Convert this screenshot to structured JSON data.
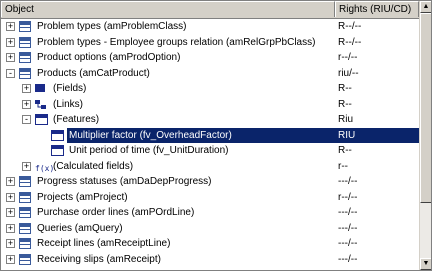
{
  "header": {
    "col_object": "Object",
    "col_rights": "Rights (RIU/CD)"
  },
  "rows": [
    {
      "label": "Problem types (amProblemClass)",
      "rights": "R--/--",
      "level": 0,
      "expander": "+",
      "icon": "table-icon"
    },
    {
      "label": "Problem types - Employee groups relation (amRelGrpPbClass)",
      "rights": "R--/--",
      "level": 0,
      "expander": "+",
      "icon": "table-icon"
    },
    {
      "label": "Product options (amProdOption)",
      "rights": "r--/--",
      "level": 0,
      "expander": "+",
      "icon": "table-icon"
    },
    {
      "label": "Products (amCatProduct)",
      "rights": "riu/--",
      "level": 0,
      "expander": "-",
      "icon": "table-icon"
    },
    {
      "label": "(Fields)",
      "rights": "R--",
      "level": 1,
      "expander": "+",
      "icon": "fields-icon"
    },
    {
      "label": "(Links)",
      "rights": "R--",
      "level": 1,
      "expander": "+",
      "icon": "links-icon"
    },
    {
      "label": "(Features)",
      "rights": "Riu",
      "level": 1,
      "expander": "-",
      "icon": "feature-icon"
    },
    {
      "label": "Multiplier factor (fv_OverheadFactor)",
      "rights": "RIU",
      "level": 2,
      "expander": "",
      "icon": "feature-icon",
      "selected": true
    },
    {
      "label": "Unit period of time (fv_UnitDuration)",
      "rights": "R--",
      "level": 2,
      "expander": "",
      "icon": "feature-icon"
    },
    {
      "label": "(Calculated fields)",
      "rights": "r--",
      "level": 1,
      "expander": "+",
      "icon": "calc-icon"
    },
    {
      "label": "Progress statuses (amDaDepProgress)",
      "rights": "---/--",
      "level": 0,
      "expander": "+",
      "icon": "table-icon"
    },
    {
      "label": "Projects (amProject)",
      "rights": "r--/--",
      "level": 0,
      "expander": "+",
      "icon": "table-icon"
    },
    {
      "label": "Purchase order lines (amPOrdLine)",
      "rights": "---/--",
      "level": 0,
      "expander": "+",
      "icon": "table-icon"
    },
    {
      "label": "Queries (amQuery)",
      "rights": "---/--",
      "level": 0,
      "expander": "+",
      "icon": "table-icon"
    },
    {
      "label": "Receipt lines (amReceiptLine)",
      "rights": "---/--",
      "level": 0,
      "expander": "+",
      "icon": "table-icon"
    },
    {
      "label": "Receiving slips (amReceipt)",
      "rights": "---/--",
      "level": 0,
      "expander": "+",
      "icon": "table-icon"
    }
  ],
  "calc_icon_glyph": "f(x)",
  "scrollbar": {
    "up": "▲",
    "down": "▼"
  }
}
